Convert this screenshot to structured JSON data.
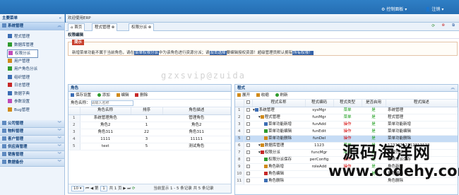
{
  "topbar": {
    "settings_label": "控制面板",
    "logout_label": "注销"
  },
  "sidebar": {
    "title": "主要菜单",
    "active_group": "系统管理",
    "items": [
      {
        "label": "程式管理",
        "selected": false
      },
      {
        "label": "数据库管理",
        "selected": false
      },
      {
        "label": "权限分派",
        "selected": true
      },
      {
        "label": "用户管理",
        "selected": false
      },
      {
        "label": "用户角色分派",
        "selected": false
      },
      {
        "label": "组织管理",
        "selected": false
      },
      {
        "label": "日志管理",
        "selected": false
      },
      {
        "label": "数据字典",
        "selected": false
      },
      {
        "label": "参数设置",
        "selected": false
      },
      {
        "label": "Bug管理",
        "selected": false
      }
    ],
    "groups": [
      "公司管理",
      "物料管理",
      "客户管理",
      "供应商管理",
      "销售管理",
      "数据备份"
    ]
  },
  "welcome": "欢迎使用ERP",
  "tabs": [
    {
      "label": "首页"
    },
    {
      "label": "程式管理"
    },
    {
      "label": "权限分派"
    }
  ],
  "panel_title": "权限编辑",
  "hint": {
    "badge": "提示",
    "t1": "新增菜单功能不属于当前角色，请在",
    "h1": "菜单权限分派",
    "t2": "中为该角色进行资源分派；请",
    "h2": "双击选择",
    "t3": "要编辑授权资源！超级管理员默认拥有",
    "h3": "所有权限！"
  },
  "roles": {
    "title": "角色",
    "toolbar": [
      "保存设置",
      "添加",
      "编辑",
      "删除"
    ],
    "search_label": "角色名称：",
    "search_placeholder": "请输入名称",
    "headers": [
      "",
      "角色名称",
      "排序",
      "角色描述"
    ],
    "rows": [
      [
        "1",
        "系统管理角色",
        "1",
        "管理角色"
      ],
      [
        "2",
        "角色2",
        "1",
        "角色2"
      ],
      [
        "3",
        "角色311",
        "22",
        "角色311"
      ],
      [
        "4",
        "1111",
        "3",
        "11111"
      ],
      [
        "5",
        "test",
        "5",
        "测试角色"
      ]
    ],
    "pager": {
      "page_size": "10",
      "page_prefix": "第",
      "page": "1",
      "page_suffix": "共 1 页",
      "summary": "当前显示 1 - 5 条记录 共 5 条记录"
    }
  },
  "programs": {
    "title": "程式",
    "toolbar": [
      "展开",
      "收缩",
      "刷新"
    ],
    "headers": [
      "",
      "",
      "程式名称",
      "程式编码",
      "程式类型",
      "是否启用",
      "程式描述"
    ],
    "rows": [
      {
        "n": "1",
        "name": "系统管理",
        "code": "sysMgr",
        "type": "菜单",
        "enabled": "是",
        "desc": "系统管理",
        "indent": 0
      },
      {
        "n": "2",
        "name": "程式管理",
        "code": "funMgr",
        "type": "菜单",
        "enabled": "是",
        "desc": "程式管理",
        "indent": 1
      },
      {
        "n": "3",
        "name": "菜单功能新增",
        "code": "funAdd",
        "type": "操作",
        "enabled": "是",
        "desc": "菜单功能新增",
        "indent": 2
      },
      {
        "n": "4",
        "name": "菜单功能编辑",
        "code": "funEdit",
        "type": "操作",
        "enabled": "是",
        "desc": "菜单功能编辑",
        "indent": 2
      },
      {
        "n": "5",
        "name": "菜单功能删除",
        "code": "funDel",
        "type": "操作",
        "enabled": "是",
        "desc": "菜单功能删除",
        "indent": 2
      },
      {
        "n": "6",
        "name": "数据库管理",
        "code": "1123",
        "type": "菜单",
        "enabled": "是",
        "desc": "12312312312312123",
        "indent": 1
      },
      {
        "n": "7",
        "name": "权限分派",
        "code": "funcMgr",
        "type": "菜单",
        "enabled": "是",
        "desc": "权限分派",
        "indent": 1
      },
      {
        "n": "8",
        "name": "权限分派保存",
        "code": "perConfig",
        "type": "操作",
        "enabled": "是",
        "desc": "权限分派保存",
        "indent": 2
      },
      {
        "n": "9",
        "name": "角色新增",
        "code": "roleAdd",
        "type": "操作",
        "enabled": "是",
        "desc": "角色新增",
        "indent": 2
      },
      {
        "n": "10",
        "name": "角色编辑",
        "code": "",
        "type": "",
        "enabled": "是",
        "desc": "角色编辑",
        "indent": 2
      },
      {
        "n": "11",
        "name": "角色删除",
        "code": "",
        "type": "",
        "enabled": "",
        "desc": "角色删除",
        "indent": 2
      }
    ]
  },
  "watermark": "gzxsvip@zuida",
  "brand": {
    "name": "源码海洋网",
    "url": "www.codehy.com"
  }
}
